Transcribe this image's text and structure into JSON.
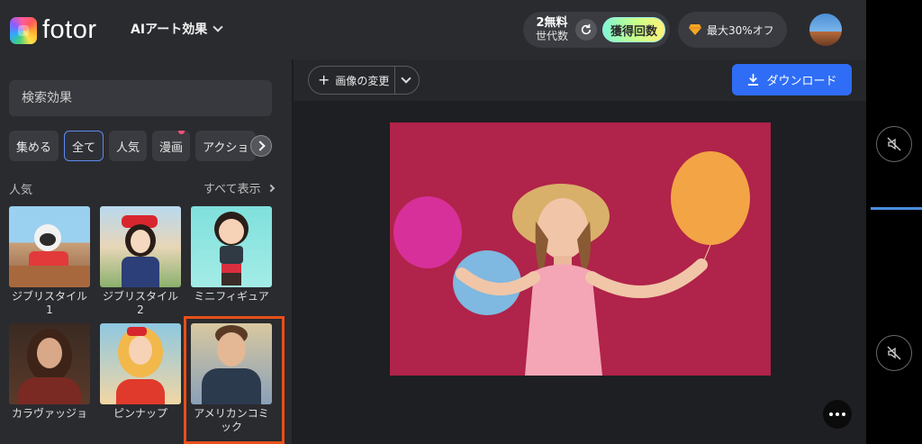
{
  "header": {
    "logo_text": "fotor",
    "mode_label": "AIアート効果",
    "credits_count": "2無料",
    "credits_label": "世代数",
    "get_credits_label": "獲得回数",
    "discount_label": "最大30%オフ"
  },
  "sidebar": {
    "search_placeholder": "検索効果",
    "chips": [
      {
        "label": "集める"
      },
      {
        "label": "全て",
        "active": true
      },
      {
        "label": "人気"
      },
      {
        "label": "漫画",
        "has_dot": true
      },
      {
        "label": "アクショ"
      }
    ],
    "section_title": "人気",
    "view_all_label": "すべて表示",
    "styles": [
      {
        "label_line1": "ジブリスタイル",
        "label_line2": "1"
      },
      {
        "label_line1": "ジブリスタイル",
        "label_line2": "2"
      },
      {
        "label_line1": "ミニフィギュア",
        "label_line2": ""
      },
      {
        "label_line1": "カラヴァッジョ",
        "label_line2": ""
      },
      {
        "label_line1": "ピンナップ",
        "label_line2": ""
      },
      {
        "label_line1": "アメリカンコミ",
        "label_line2": "ック",
        "selected": true
      }
    ]
  },
  "toolbar": {
    "change_image_label": "画像の変更",
    "download_label": "ダウンロード"
  },
  "colors": {
    "accent_blue": "#2f6df6",
    "selection_orange": "#e8501b",
    "photo_background": "#b0234a"
  }
}
